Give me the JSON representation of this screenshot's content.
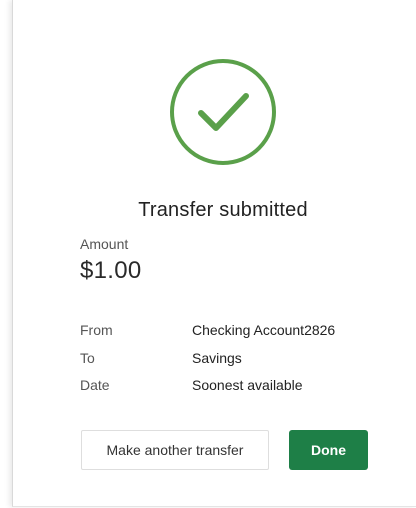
{
  "status": {
    "icon": "checkmark-circle-icon",
    "color": "#5aa04a",
    "title": "Transfer submitted"
  },
  "amount": {
    "label": "Amount",
    "value": "$1.00"
  },
  "details": [
    {
      "label": "From",
      "value": "Checking Account2826"
    },
    {
      "label": "To",
      "value": "Savings"
    },
    {
      "label": "Date",
      "value": "Soonest available"
    }
  ],
  "actions": {
    "secondary_label": "Make another transfer",
    "primary_label": "Done",
    "primary_color": "#1e7f47"
  }
}
